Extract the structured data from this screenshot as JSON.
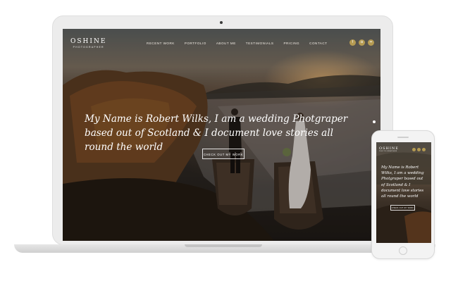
{
  "site": {
    "logo": "OSHINE",
    "tagline": "PHOTOGRAPHER"
  },
  "nav": {
    "items": [
      "RECENT WORK",
      "PORTFOLIO",
      "ABOUT ME",
      "TESTIMONIALS",
      "PRICING",
      "CONTACT"
    ]
  },
  "social": {
    "icons": [
      "facebook-icon",
      "instagram-icon",
      "flickr-icon"
    ],
    "glyphs": [
      "f",
      "◘",
      "••"
    ],
    "color": "#b59b52"
  },
  "hero": {
    "headline": "My Name is Robert Wilks, I am a wedding Photgraper based out of Scotland & I document love stories all round the world",
    "cta": "CHECK OUT MY WORK"
  },
  "mobile": {
    "logo": "OSHINE",
    "tagline": "PHOTOGRAPHER",
    "headline": "My Name is Robert Wilks, I am a wedding Photgraper based out of Scotland & I document love stories all round the world",
    "cta": "CHECK OUT MY WORK"
  }
}
